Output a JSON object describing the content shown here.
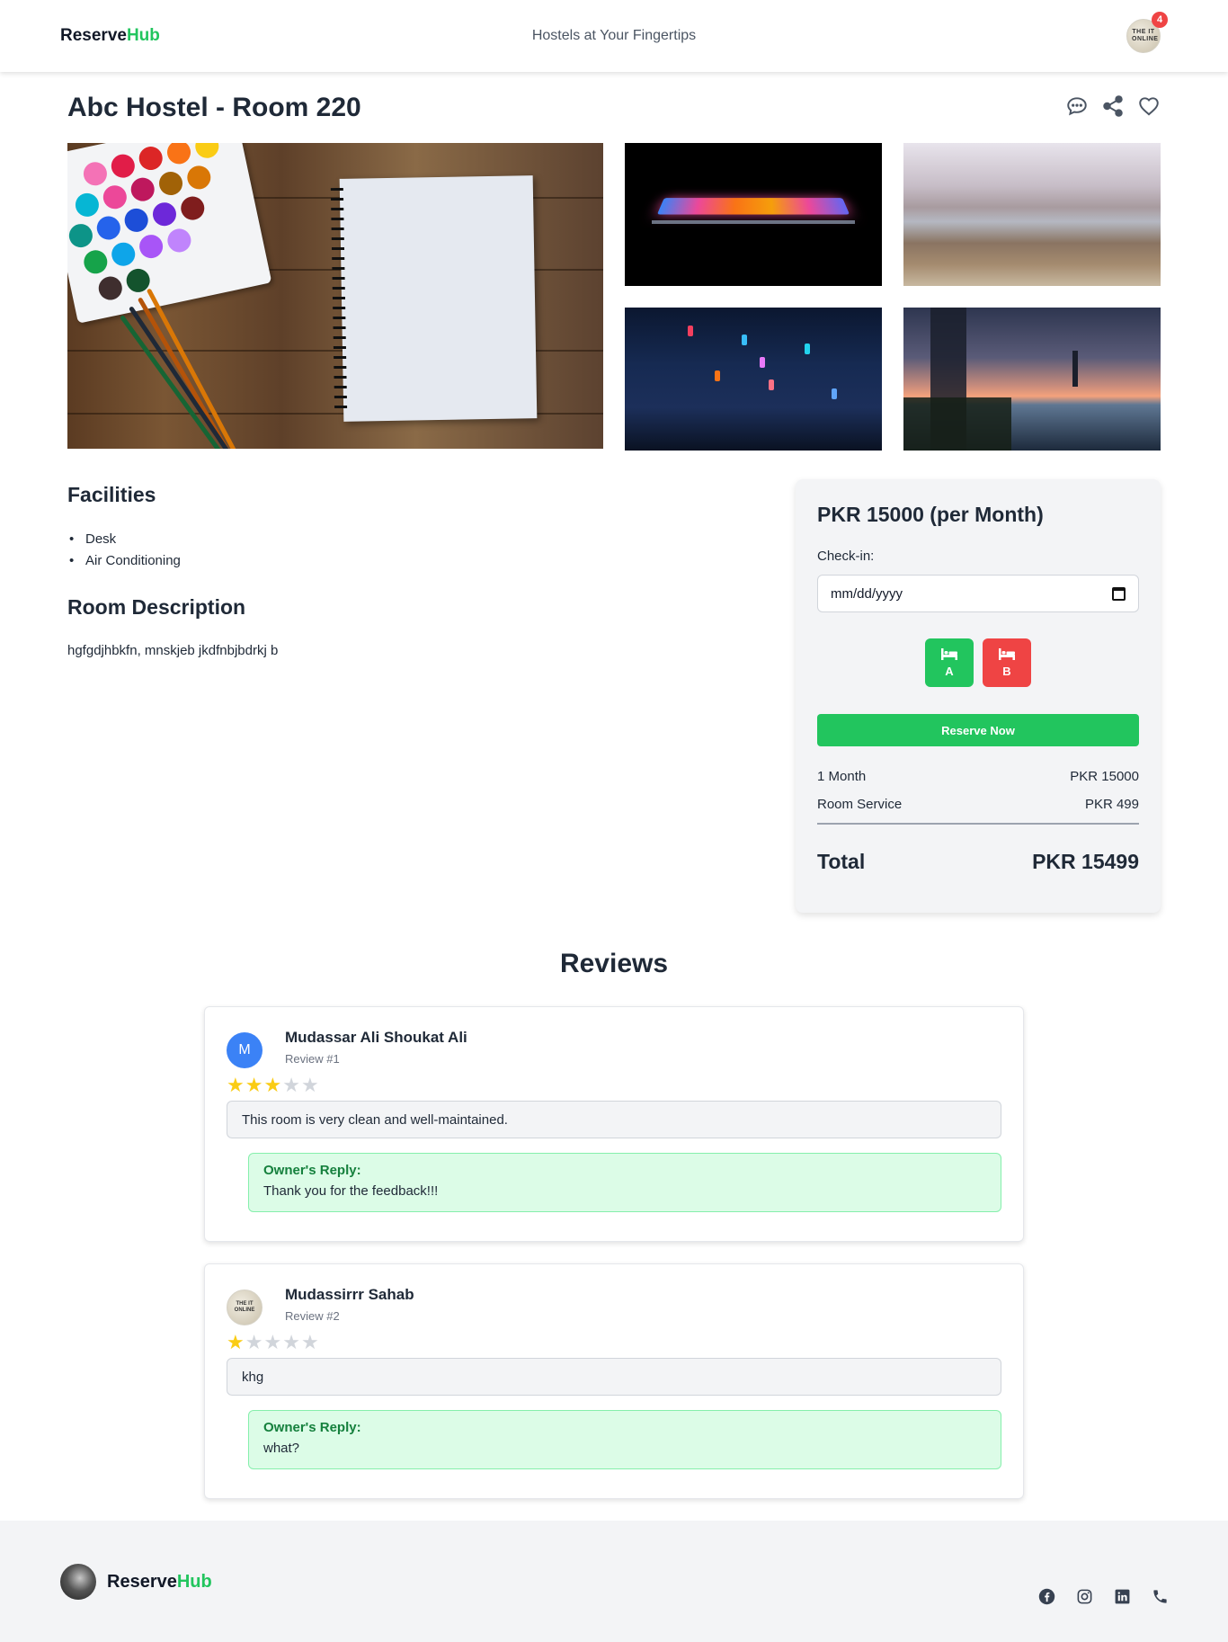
{
  "header": {
    "brand_main": "Reserve",
    "brand_accent": "Hub",
    "tagline": "Hostels at Your Fingertips",
    "notification_count": "4",
    "avatar_text": "THE IT ONLINE"
  },
  "page": {
    "title": "Abc Hostel - Room 220",
    "icons": [
      "chat-icon",
      "share-icon",
      "heart-icon"
    ]
  },
  "facilities": {
    "heading": "Facilities",
    "items": [
      "Desk",
      "Air Conditioning"
    ]
  },
  "description": {
    "heading": "Room Description",
    "text": "hgfgdjhbkfn, mnskjeb jkdfnbjbdrkj b"
  },
  "booking": {
    "price_title": "PKR 15000 (per Month)",
    "checkin_label": "Check-in:",
    "date_placeholder": "mm/dd/yyyy",
    "beds": [
      {
        "label": "A",
        "status_color": "#22c55e"
      },
      {
        "label": "B",
        "status_color": "#ef4444"
      }
    ],
    "reserve_label": "Reserve Now",
    "lines": [
      {
        "label": "1 Month",
        "value": "PKR 15000"
      },
      {
        "label": "Room Service",
        "value": "PKR 499"
      }
    ],
    "total_label": "Total",
    "total_value": "PKR 15499"
  },
  "reviews": {
    "title": "Reviews",
    "items": [
      {
        "avatar_letter": "M",
        "name": "Mudassar Ali Shoukat Ali",
        "number": "Review #1",
        "rating": 3,
        "max_rating": 5,
        "comment": "This room is very clean and well-maintained.",
        "reply_label": "Owner's Reply:",
        "reply_text": "Thank you for the feedback!!!"
      },
      {
        "avatar_letter": "",
        "name": "Mudassirrr Sahab",
        "number": "Review #2",
        "rating": 1,
        "max_rating": 5,
        "comment": "khg",
        "reply_label": "Owner's Reply:",
        "reply_text": "what?"
      }
    ]
  },
  "footer": {
    "brand_main": "Reserve",
    "brand_accent": "Hub",
    "social_icons": [
      "facebook-icon",
      "instagram-icon",
      "linkedin-icon",
      "phone-icon"
    ]
  },
  "colors": {
    "accent_green": "#22c55e",
    "danger_red": "#ef4444",
    "star_gold": "#facc15"
  }
}
